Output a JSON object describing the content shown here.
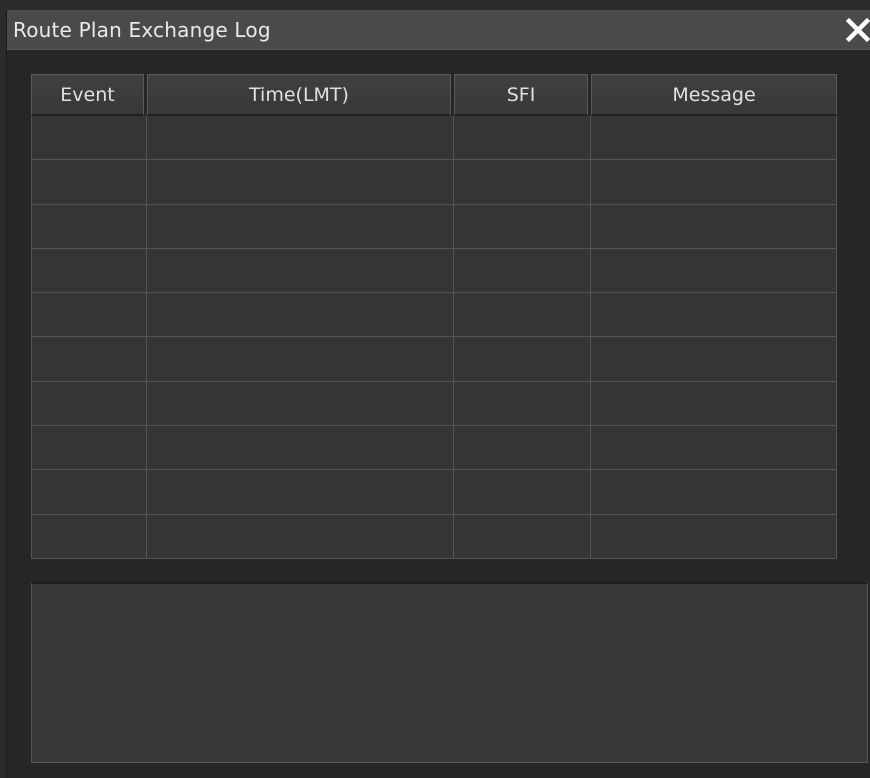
{
  "window": {
    "title": "Route Plan Exchange Log"
  },
  "table": {
    "columns": [
      "Event",
      "Time(LMT)",
      "SFI",
      "Message"
    ],
    "rows": [
      [
        "",
        "",
        "",
        ""
      ],
      [
        "",
        "",
        "",
        ""
      ],
      [
        "",
        "",
        "",
        ""
      ],
      [
        "",
        "",
        "",
        ""
      ],
      [
        "",
        "",
        "",
        ""
      ],
      [
        "",
        "",
        "",
        ""
      ],
      [
        "",
        "",
        "",
        ""
      ],
      [
        "",
        "",
        "",
        ""
      ],
      [
        "",
        "",
        "",
        ""
      ],
      [
        "",
        "",
        "",
        ""
      ]
    ]
  },
  "message_area": {
    "text": ""
  },
  "icons": {
    "close": "close-icon"
  },
  "colors": {
    "titlebar": "#4a4a4a",
    "background": "#262626",
    "cell": "#353535",
    "text": "#e6e6e6"
  }
}
